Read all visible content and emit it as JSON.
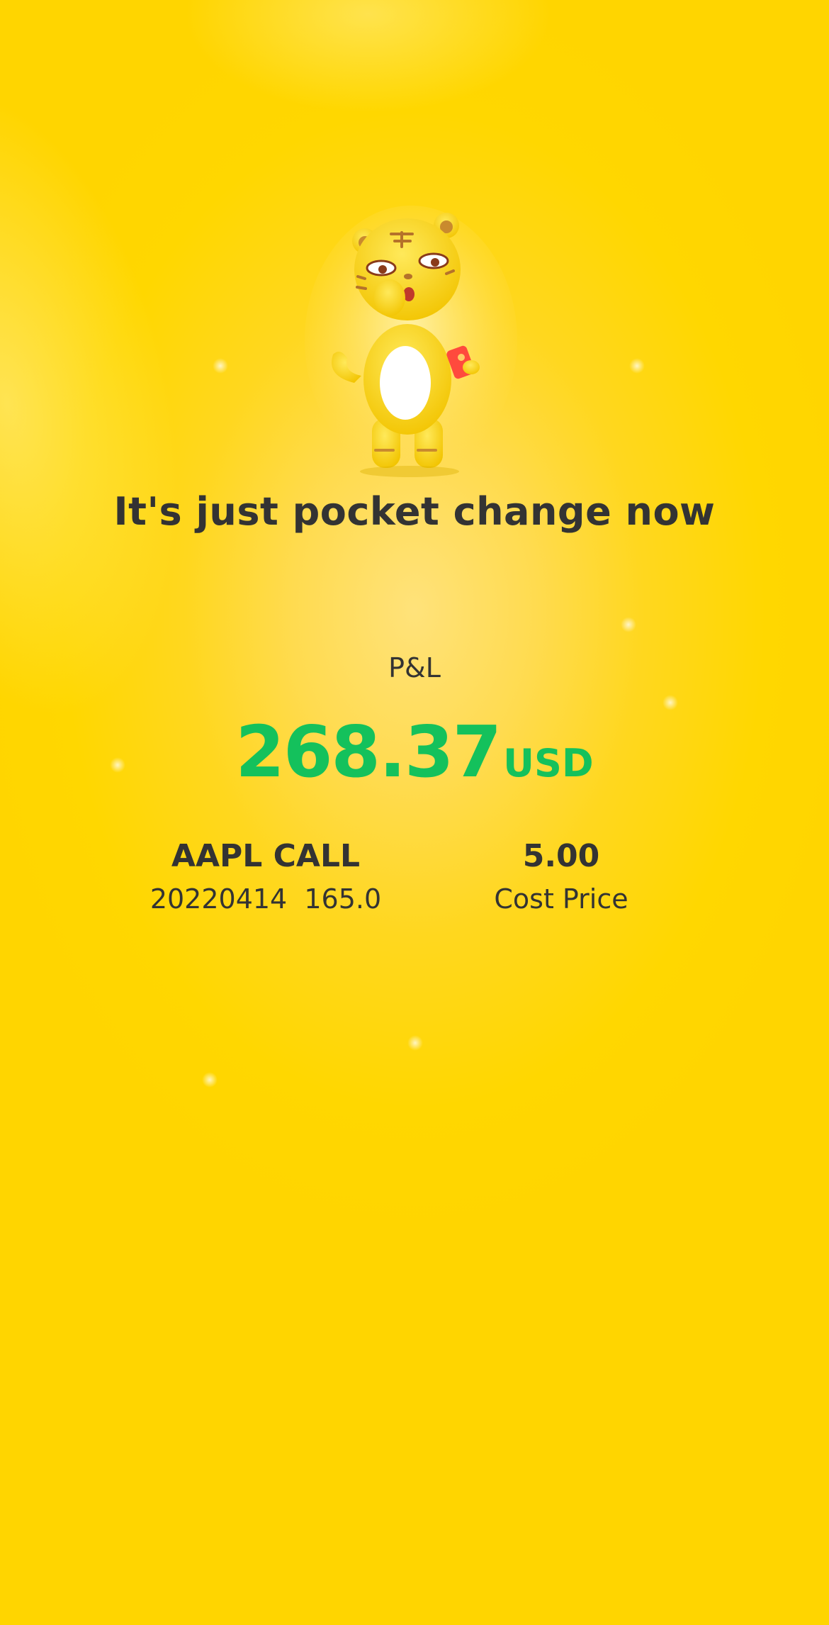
{
  "headline": "It's just pocket change now",
  "pnl": {
    "label": "P&L",
    "value": "268.37",
    "currency": "USD",
    "value_color": "#14c15c"
  },
  "position": {
    "contract": "AAPL CALL",
    "expiry_strike": "20220414  165.0"
  },
  "cost": {
    "value": "5.00",
    "label": "Cost Price"
  },
  "mascot": {
    "icon": "tiger-mascot-with-red-envelope"
  },
  "colors": {
    "background": "#ffd700",
    "text": "#333333",
    "profit_green": "#14c15c"
  }
}
